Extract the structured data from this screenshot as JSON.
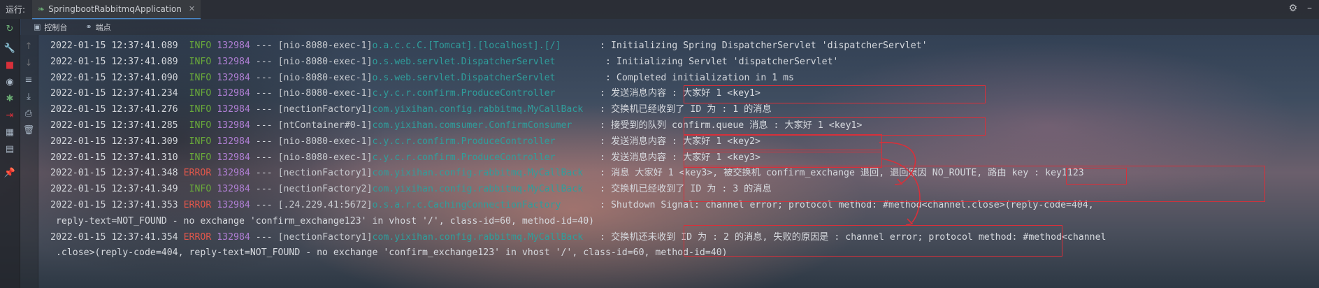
{
  "topbar": {
    "run_label": "运行:",
    "run_tab": "SpringbootRabbitmqApplication"
  },
  "subbar": {
    "tabs": [
      {
        "label": "控制台",
        "icon": "console-icon"
      },
      {
        "label": "端点",
        "icon": "endpoints-icon"
      }
    ]
  },
  "colors": {
    "info": "#6aab3a",
    "error": "#e3574b",
    "pid": "#b07fd4",
    "logger": "#2f9e9c",
    "highlight": "#d8303a"
  },
  "log": [
    {
      "date": "2022-01-15 12:37:41.089",
      "level": " INFO",
      "pid": "132984",
      "sep": " --- ",
      "thread": "[nio-8080-exec-1]",
      "logger": "o.a.c.c.C.[Tomcat].[localhost].[/]      ",
      "colon": " : ",
      "msg": "Initializing Spring DispatcherServlet 'dispatcherServlet'"
    },
    {
      "date": "2022-01-15 12:37:41.089",
      "level": " INFO",
      "pid": "132984",
      "sep": " --- ",
      "thread": "[nio-8080-exec-1]",
      "logger": "o.s.web.servlet.DispatcherServlet        ",
      "colon": " : ",
      "msg": "Initializing Servlet 'dispatcherServlet'"
    },
    {
      "date": "2022-01-15 12:37:41.090",
      "level": " INFO",
      "pid": "132984",
      "sep": " --- ",
      "thread": "[nio-8080-exec-1]",
      "logger": "o.s.web.servlet.DispatcherServlet        ",
      "colon": " : ",
      "msg": "Completed initialization in 1 ms"
    },
    {
      "date": "2022-01-15 12:37:41.234",
      "level": " INFO",
      "pid": "132984",
      "sep": " --- ",
      "thread": "[nio-8080-exec-1]",
      "logger": "c.y.c.r.confirm.ProduceController       ",
      "colon": " : ",
      "msg": "发送消息内容 : 大家好 1 <key1>"
    },
    {
      "date": "2022-01-15 12:37:41.276",
      "level": " INFO",
      "pid": "132984",
      "sep": " --- ",
      "thread": "[nectionFactory1]",
      "logger": "com.yixihan.config.rabbitmq.MyCallBack  ",
      "colon": " : ",
      "msg": "交换机已经收到了 ID 为 : 1 的消息"
    },
    {
      "date": "2022-01-15 12:37:41.285",
      "level": " INFO",
      "pid": "132984",
      "sep": " --- ",
      "thread": "[ntContainer#0-1]",
      "logger": "com.yixihan.comsumer.ConfirmConsumer    ",
      "colon": " : ",
      "msg": "接受到的队列 confirm.queue 消息 : 大家好 1 <key1>"
    },
    {
      "date": "2022-01-15 12:37:41.309",
      "level": " INFO",
      "pid": "132984",
      "sep": " --- ",
      "thread": "[nio-8080-exec-1]",
      "logger": "c.y.c.r.confirm.ProduceController       ",
      "colon": " : ",
      "msg": "发送消息内容 : 大家好 1 <key2>"
    },
    {
      "date": "2022-01-15 12:37:41.310",
      "level": " INFO",
      "pid": "132984",
      "sep": " --- ",
      "thread": "[nio-8080-exec-1]",
      "logger": "c.y.c.r.confirm.ProduceController       ",
      "colon": " : ",
      "msg": "发送消息内容 : 大家好 1 <key3>"
    },
    {
      "date": "2022-01-15 12:37:41.348",
      "level": "ERROR",
      "pid": "132984",
      "sep": " --- ",
      "thread": "[nectionFactory1]",
      "logger": "com.yixihan.config.rabbitmq.MyCallBack  ",
      "colon": " : ",
      "msg": "消息 大家好 1 <key3>, 被交换机 confirm_exchange 退回, 退回原因 NO_ROUTE, 路由 key : key1123"
    },
    {
      "date": "2022-01-15 12:37:41.349",
      "level": " INFO",
      "pid": "132984",
      "sep": " --- ",
      "thread": "[nectionFactory2]",
      "logger": "com.yixihan.config.rabbitmq.MyCallBack  ",
      "colon": " : ",
      "msg": "交换机已经收到了 ID 为 : 3 的消息"
    },
    {
      "date": "2022-01-15 12:37:41.353",
      "level": "ERROR",
      "pid": "132984",
      "sep": " --- ",
      "thread": "[.24.229.41:5672]",
      "logger": "o.s.a.r.c.CachingConnectionFactory      ",
      "colon": " : ",
      "msg": "Shutdown Signal: channel error; protocol method: #method<channel.close>(reply-code=404,"
    },
    {
      "continuation": " reply-text=NOT_FOUND - no exchange 'confirm_exchange123' in vhost '/', class-id=60, method-id=40)"
    },
    {
      "date": "2022-01-15 12:37:41.354",
      "level": "ERROR",
      "pid": "132984",
      "sep": " --- ",
      "thread": "[nectionFactory1]",
      "logger": "com.yixihan.config.rabbitmq.MyCallBack  ",
      "colon": " : ",
      "msg": "交换机还未收到 ID 为 : 2 的消息, 失败的原因是 : channel error; protocol method: #method<channel"
    },
    {
      "continuation": " .close>(reply-code=404, reply-text=NOT_FOUND - no exchange 'confirm_exchange123' in vhost '/', class-id=60, method-id=40)"
    }
  ]
}
